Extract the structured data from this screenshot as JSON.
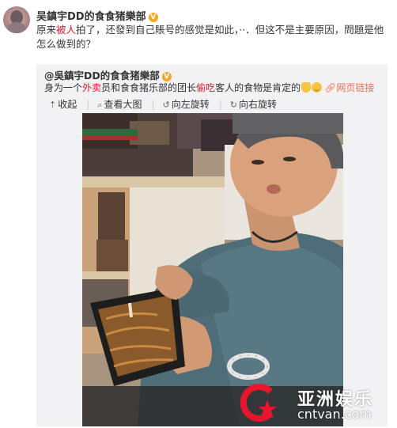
{
  "post": {
    "author": "吴鎮宇DD的食食猪樂部",
    "badge": "V",
    "text_1": "原来",
    "text_hl": "被人",
    "text_2": "拍了，还發到自己賬号的感觉是如此，··．但这不是主要原因，問題是他怎么做到的？"
  },
  "quote": {
    "author": "@吳鎮宇DD的食食猪樂部",
    "badge": "V",
    "text_1": "身为一个",
    "text_hl1": "外卖",
    "text_2": "员和食食猪乐部的团长",
    "text_hl2": "偷吃",
    "text_3": "客人的食物是肯定的",
    "weblink": "网页链接",
    "actions": {
      "collapse": "收起",
      "view_large": "查看大图",
      "rotate_left": "向左旋转",
      "rotate_right": "向右旋转"
    }
  },
  "watermark": {
    "title": "亚洲娱乐",
    "url": "cntvan.com"
  },
  "colors": {
    "highlight": "#e6162d",
    "link": "#eb7350",
    "badge": "#f5a623",
    "quote_bg": "#f2f2f5"
  }
}
